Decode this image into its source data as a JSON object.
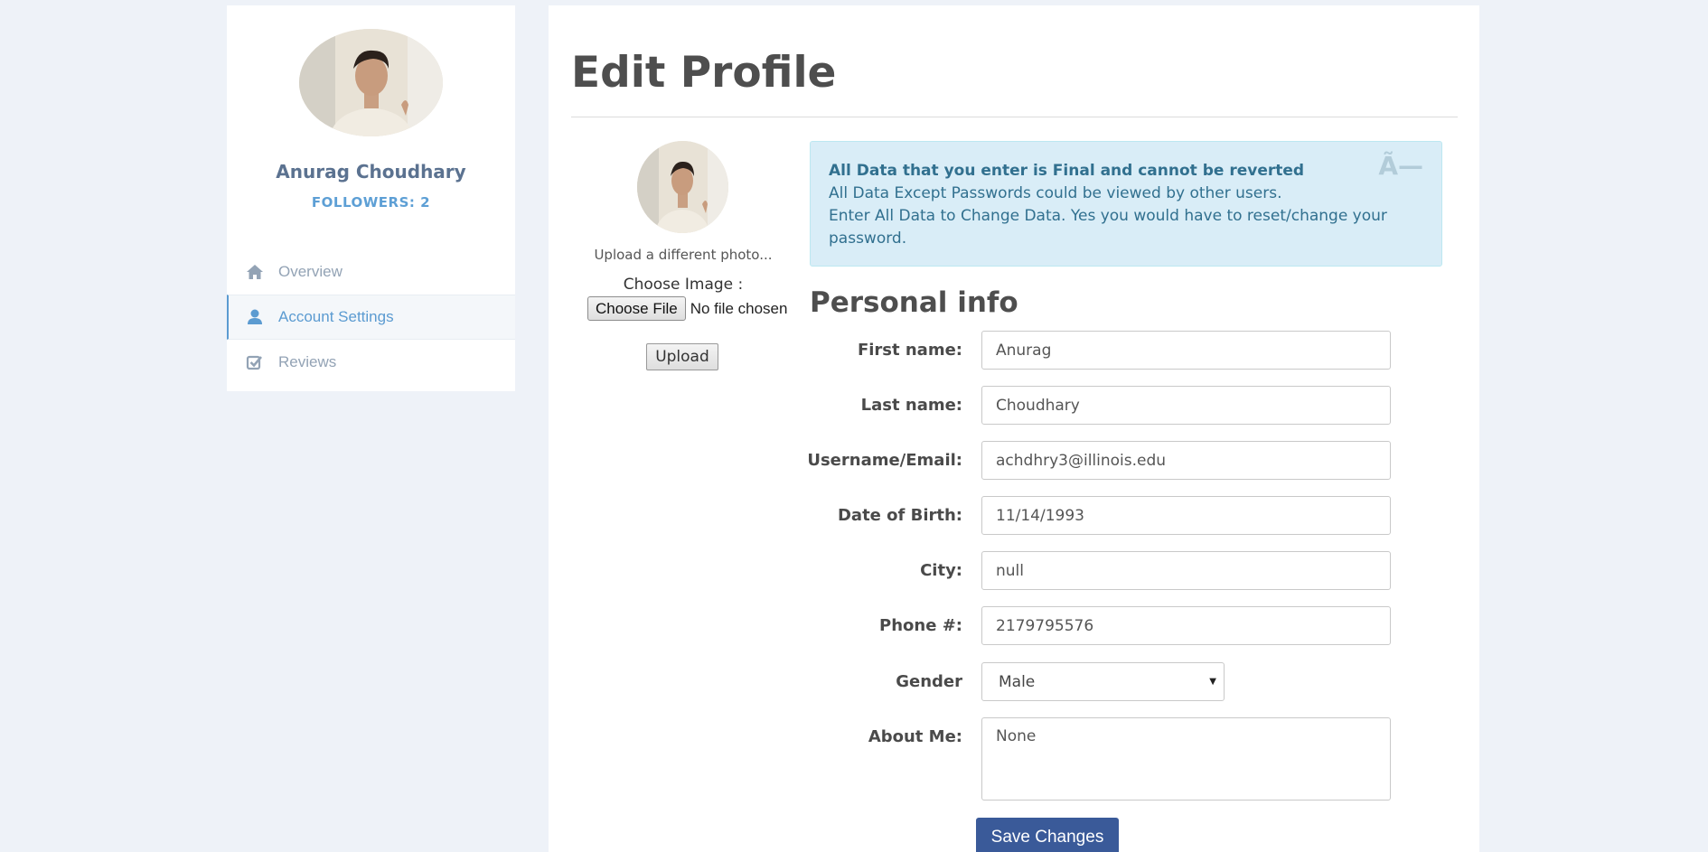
{
  "profile": {
    "name": "Anurag Choudhary",
    "followers": "FOLLOWERS: 2"
  },
  "nav": {
    "items": [
      {
        "label": "Overview",
        "icon": "home-icon"
      },
      {
        "label": "Account Settings",
        "icon": "user-icon"
      },
      {
        "label": "Reviews",
        "icon": "check-icon"
      }
    ]
  },
  "main": {
    "title": "Edit Profile",
    "upload_note": "Upload a different photo...",
    "choose_image_label": "Choose Image :",
    "choose_file_button": "Choose File",
    "no_file_text": "No file chosen",
    "upload_button": "Upload"
  },
  "alert": {
    "title": "All Data that you enter is Final and cannot be reverted",
    "line1": "All Data Except Passwords could be viewed by other users.",
    "line2": "Enter All Data to Change Data. Yes you would have to reset/change your password.",
    "close": "Ã—"
  },
  "form": {
    "section_title": "Personal info",
    "first_name": {
      "label": "First name:",
      "value": "Anurag"
    },
    "last_name": {
      "label": "Last name:",
      "value": "Choudhary"
    },
    "email": {
      "label": "Username/Email:",
      "value": "achdhry3@illinois.edu"
    },
    "dob": {
      "label": "Date of Birth:",
      "value": "11/14/1993"
    },
    "city": {
      "label": "City:",
      "value": "null"
    },
    "phone": {
      "label": "Phone #:",
      "value": "2179795576"
    },
    "gender": {
      "label": "Gender",
      "value": "Male"
    },
    "about": {
      "label": "About Me:",
      "value": "None"
    },
    "save_button": "Save Changes"
  },
  "colors": {
    "accent": "#5b9bd1",
    "primary_button": "#3a5a99",
    "alert_bg": "#d9edf7",
    "alert_text": "#31708f"
  }
}
